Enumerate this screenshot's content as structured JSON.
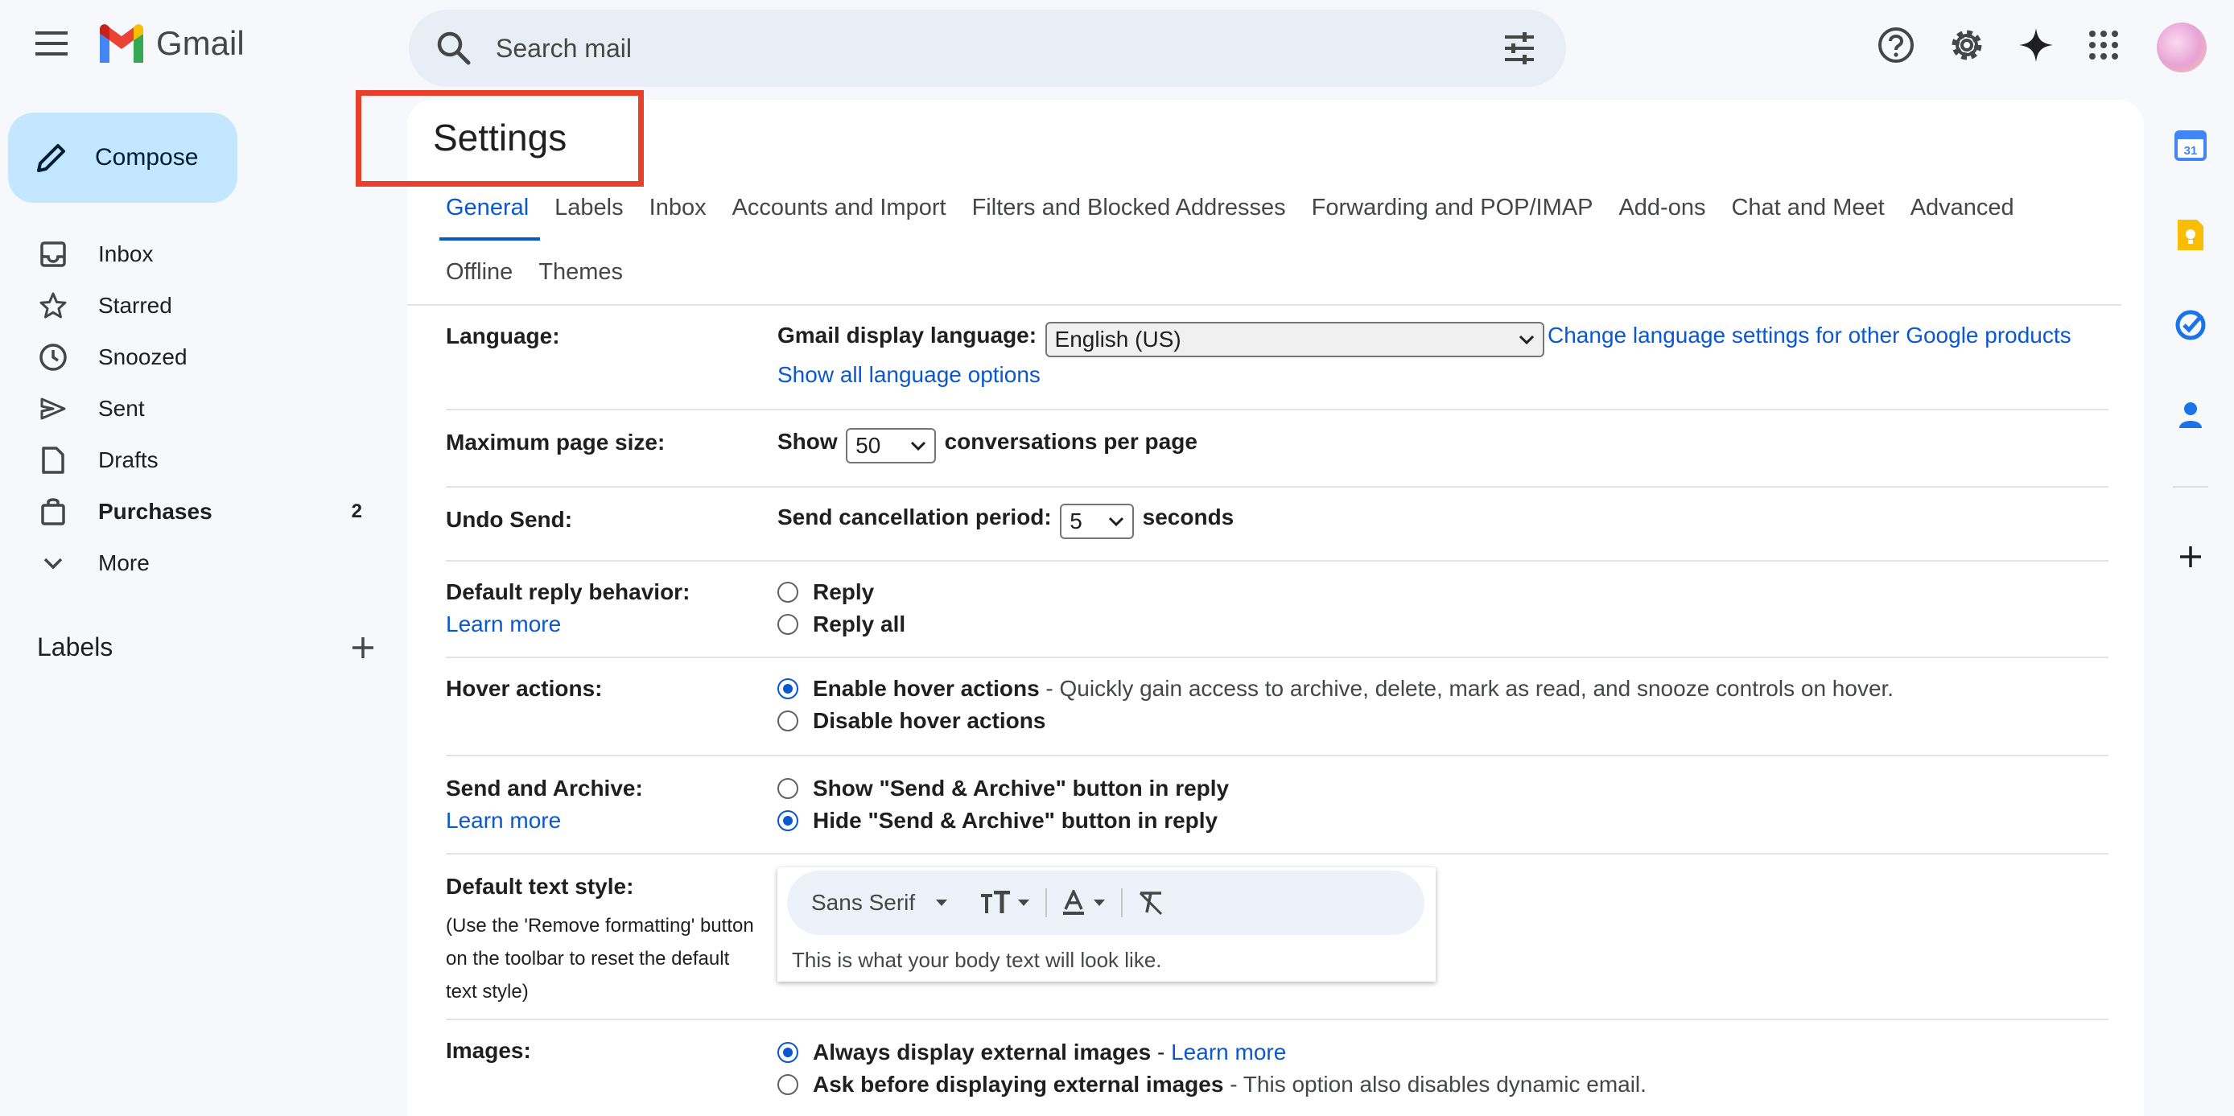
{
  "header": {
    "app_name": "Gmail",
    "search_placeholder": "Search mail"
  },
  "compose": {
    "label": "Compose"
  },
  "nav": {
    "items": [
      {
        "label": "Inbox",
        "icon": "inbox-icon",
        "count": ""
      },
      {
        "label": "Starred",
        "icon": "star-icon",
        "count": ""
      },
      {
        "label": "Snoozed",
        "icon": "clock-icon",
        "count": ""
      },
      {
        "label": "Sent",
        "icon": "send-icon",
        "count": ""
      },
      {
        "label": "Drafts",
        "icon": "draft-icon",
        "count": ""
      },
      {
        "label": "Purchases",
        "icon": "shopping-bag-icon",
        "count": "2"
      },
      {
        "label": "More",
        "icon": "chevron-down-icon",
        "count": ""
      }
    ],
    "labels_heading": "Labels"
  },
  "settings": {
    "title": "Settings",
    "tabs_row1": [
      "General",
      "Labels",
      "Inbox",
      "Accounts and Import",
      "Filters and Blocked Addresses",
      "Forwarding and POP/IMAP",
      "Add-ons",
      "Chat and Meet",
      "Advanced"
    ],
    "tabs_row2": [
      "Offline",
      "Themes"
    ],
    "language": {
      "label": "Language:",
      "display_label": "Gmail display language:",
      "selected": "English (US)",
      "change_link": "Change language settings for other Google products",
      "show_all_link": "Show all language options"
    },
    "page_size": {
      "label": "Maximum page size:",
      "show": "Show",
      "selected": "50",
      "suffix": "conversations per page"
    },
    "undo_send": {
      "label": "Undo Send:",
      "prefix": "Send cancellation period:",
      "selected": "5",
      "suffix": "seconds"
    },
    "reply": {
      "label": "Default reply behavior:",
      "learn_more": "Learn more",
      "options": [
        "Reply",
        "Reply all"
      ]
    },
    "hover": {
      "label": "Hover actions:",
      "enable": "Enable hover actions",
      "enable_desc": "- Quickly gain access to archive, delete, mark as read, and snooze controls on hover.",
      "disable": "Disable hover actions"
    },
    "send_archive": {
      "label": "Send and Archive:",
      "learn_more": "Learn more",
      "show": "Show \"Send & Archive\" button in reply",
      "hide": "Hide \"Send & Archive\" button in reply"
    },
    "text_style": {
      "label": "Default text style:",
      "note_lines": [
        "(Use the 'Remove formatting' button",
        "on the toolbar to reset the default",
        "text style)"
      ],
      "font": "Sans Serif",
      "sample": "This is what your body text will look like."
    },
    "images": {
      "label": "Images:",
      "always": "Always display external images",
      "dash": " - ",
      "learn_more": "Learn more",
      "ask": "Ask before displaying external images",
      "ask_desc": "- This option also disables dynamic email."
    }
  },
  "colors": {
    "accent": "#0b57d0",
    "compose_bg": "#c2e7ff",
    "highlight": "#e8402a"
  }
}
